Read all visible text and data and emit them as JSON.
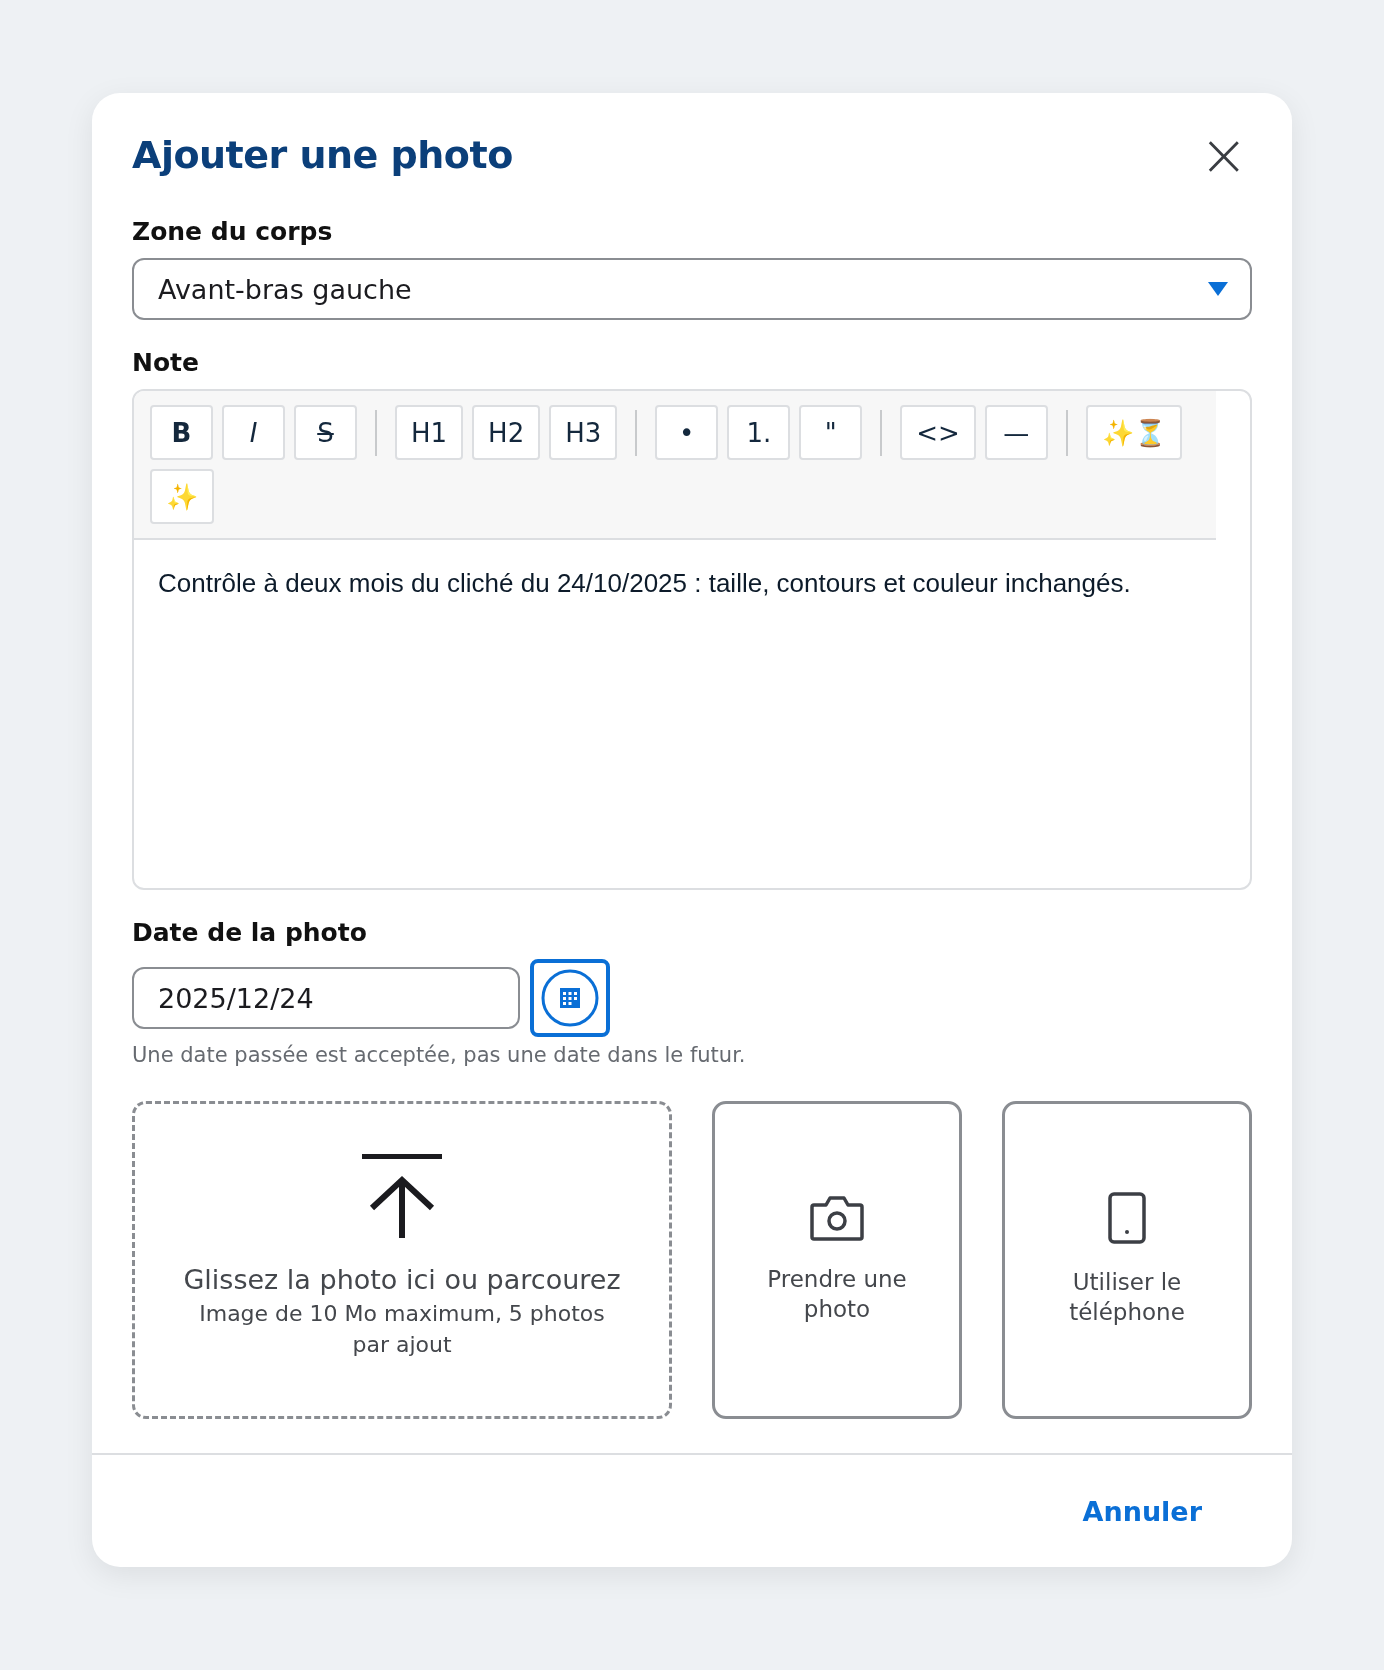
{
  "dialog": {
    "title": "Ajouter une photo",
    "close": "×"
  },
  "body_zone": {
    "label": "Zone du corps",
    "value": "Avant-bras gauche"
  },
  "note": {
    "label": "Note",
    "toolbar": [
      [
        {
          "label": "B",
          "kind": "bold"
        },
        {
          "label": "I",
          "kind": "italic"
        },
        {
          "label": "S",
          "kind": "strike"
        }
      ],
      [
        {
          "label": "H1",
          "kind": "plain"
        },
        {
          "label": "H2",
          "kind": "plain"
        },
        {
          "label": "H3",
          "kind": "plain"
        }
      ],
      [
        {
          "label": "•",
          "kind": "plain"
        },
        {
          "label": "1.",
          "kind": "plain"
        },
        {
          "label": "\"",
          "kind": "plain"
        }
      ],
      [
        {
          "label": "<>",
          "kind": "plain"
        },
        {
          "label": "—",
          "kind": "plain"
        }
      ],
      [
        {
          "label": "✨⏳",
          "kind": "plain"
        },
        {
          "label": "✨",
          "kind": "plain"
        }
      ]
    ],
    "text": "Contrôle à deux mois du cliché du 24/10/2025 : taille, contours et couleur inchangés."
  },
  "date": {
    "label": "Date de la photo",
    "value": "2025/12/24",
    "hint": "Une date passée est acceptée, pas une date dans le futur."
  },
  "upload": {
    "title": "Glissez la photo ici ou parcourez",
    "subtitle": "Image de 10 Mo maximum, 5 photos par ajout",
    "options": [
      {
        "kind": "camera",
        "label": "Prendre une photo"
      },
      {
        "kind": "phone",
        "label": "Utiliser le téléphone"
      }
    ]
  },
  "footer": {
    "cancel": "Annuler"
  }
}
